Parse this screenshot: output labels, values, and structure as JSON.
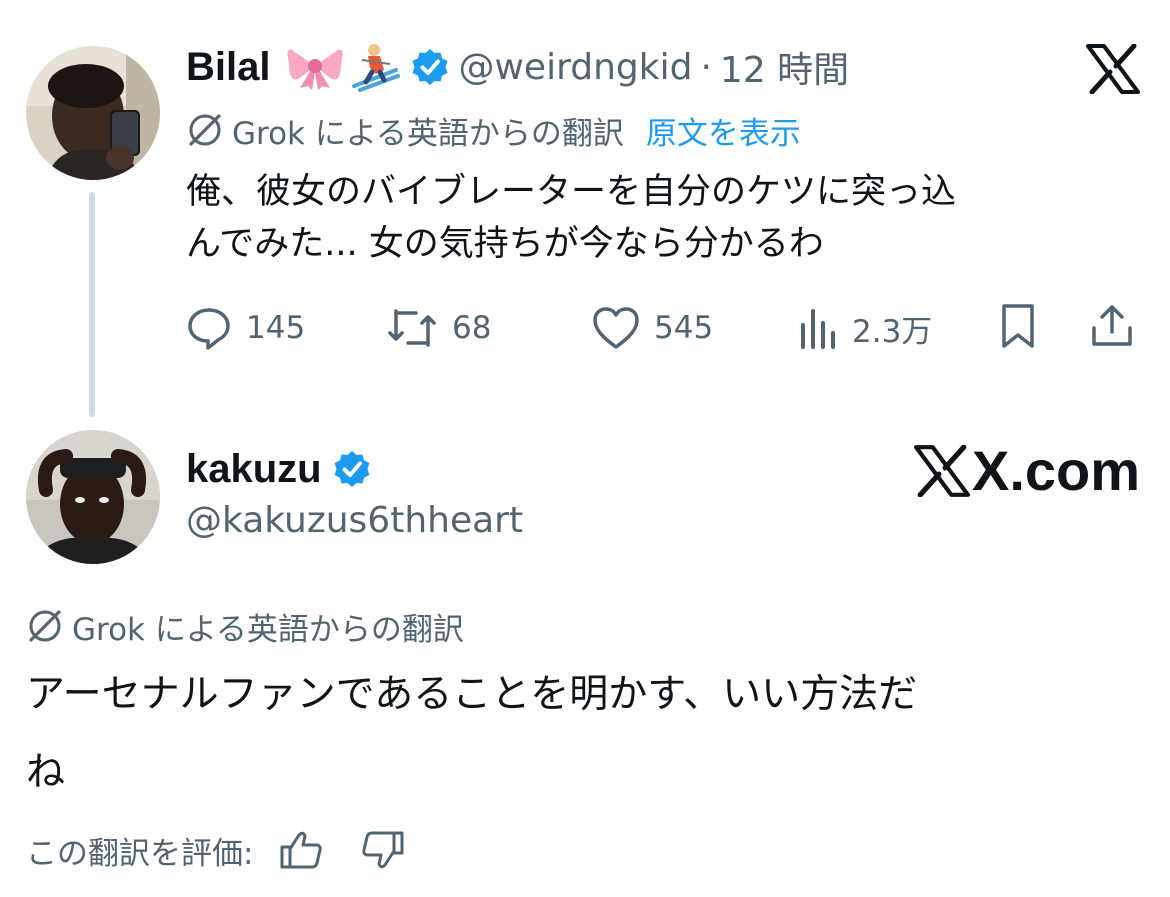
{
  "original_tweet": {
    "name": "Bilal",
    "emojis": [
      "ribbon-emoji",
      "skier-emoji"
    ],
    "handle": "@weirdngkid",
    "separator": "·",
    "time": "12 時間",
    "grok_label": "Grok による英語からの翻訳",
    "show_original": "原文を表示",
    "text_line1": "俺、彼女のバイブレーターを自分のケツに突っ込",
    "text_line2": "んでみた... 女の気持ちが今なら分かるわ",
    "replies": "145",
    "reposts": "68",
    "likes": "545",
    "views": "2.3万"
  },
  "reply_tweet": {
    "name": "kakuzu",
    "handle": "@kakuzus6thheart",
    "grok_label": "Grok による英語からの翻訳",
    "text_line1": "アーセナルファンであることを明かす、いい方法だ",
    "text_line2": "ね",
    "rate_label": "この翻訳を評価:"
  },
  "branding": {
    "watermark": "X.com"
  },
  "colors": {
    "verified": "#1d9bf0",
    "link": "#1d9bf0",
    "secondary": "#536471",
    "text": "#0f1419",
    "thread_line": "#cfd9de"
  },
  "icons": [
    "x-logo-icon",
    "verified-badge-icon",
    "grok-icon",
    "reply-icon",
    "repost-icon",
    "like-icon",
    "views-icon",
    "bookmark-icon",
    "share-icon",
    "thumbs-up-icon",
    "thumbs-down-icon"
  ]
}
